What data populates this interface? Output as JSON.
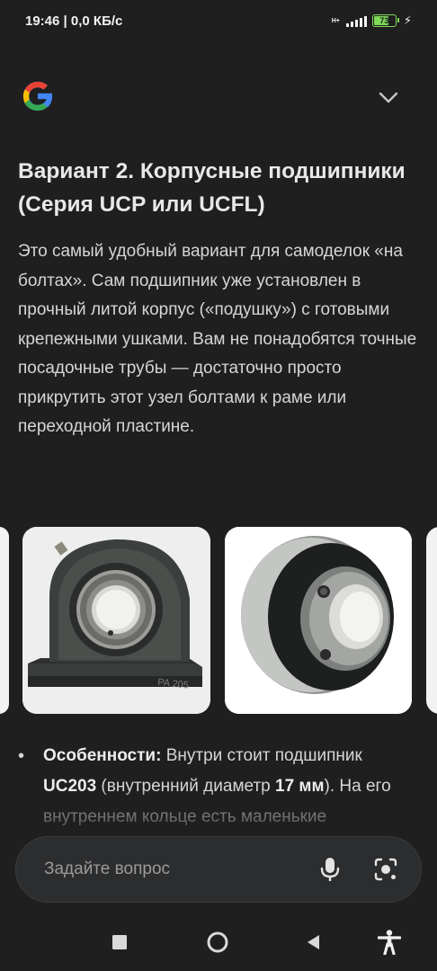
{
  "status_bar": {
    "time_speed": "19:46 | 0,0 КБ/с",
    "net_type_top": "H+",
    "net_type_bottom": "ıl",
    "battery_level": "73",
    "battery_fraction": 0.73
  },
  "header": {
    "logo_icon": "google-g-icon",
    "collapse_icon": "chevron-down-icon"
  },
  "article": {
    "title": "Вариант 2. Корпусные подшипники (Серия UCP или UCFL)",
    "paragraph": "Это самый удобный вариант для самоделок «на болтах». Сам подшипник уже установлен в прочный литой корпус («подушку») с готовыми крепежными ушками. Вам не понадобятся точные посадочные трубы — достаточно просто прикрутить этот узел болтами к раме или переходной пластине.",
    "images": [
      {
        "name": "pillow-block-bearing",
        "housing_marking": "PA 205"
      },
      {
        "name": "insert-bearing"
      }
    ],
    "bullet": {
      "label": "Особенности:",
      "text_1": " Внутри стоит подшипник ",
      "model": "UC203",
      "text_2": " (внутренний диаметр ",
      "diameter": "17 мм",
      "text_3": "). На его внутреннем кольце есть маленькие"
    }
  },
  "ask_bar": {
    "placeholder": "Задайте вопрос",
    "mic_icon": "microphone-icon",
    "lens_icon": "camera-lens-icon"
  },
  "nav_bar": {
    "recents_icon": "square-icon",
    "home_icon": "circle-icon",
    "back_icon": "back-triangle-icon",
    "accessibility_icon": "accessibility-icon"
  },
  "colors": {
    "background": "#1f1f1f",
    "text": "#d6d6d6",
    "battery": "#7ed957",
    "ask_bar": "#2c2d2f"
  }
}
